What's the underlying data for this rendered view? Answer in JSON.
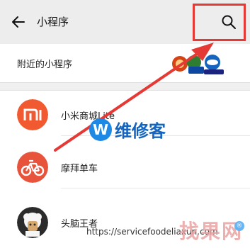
{
  "header": {
    "title": "小程序"
  },
  "nearby": {
    "label": "附近的小程序"
  },
  "list": [
    {
      "name": "小米商城Lite",
      "avatar_text": "mi",
      "color": "#f15a31"
    },
    {
      "name": "摩拜单车",
      "color": "#e8533c"
    },
    {
      "name": "头脑王者"
    }
  ],
  "watermarks": {
    "wei_logo": "W",
    "wei_text": "维修客",
    "url": "https://servicefoodeliaxun.com",
    "zhaoguowang": "找果网",
    "badge": "®"
  },
  "colors": {
    "annotation_red": "#e53935",
    "header_bg": "#ededed"
  }
}
